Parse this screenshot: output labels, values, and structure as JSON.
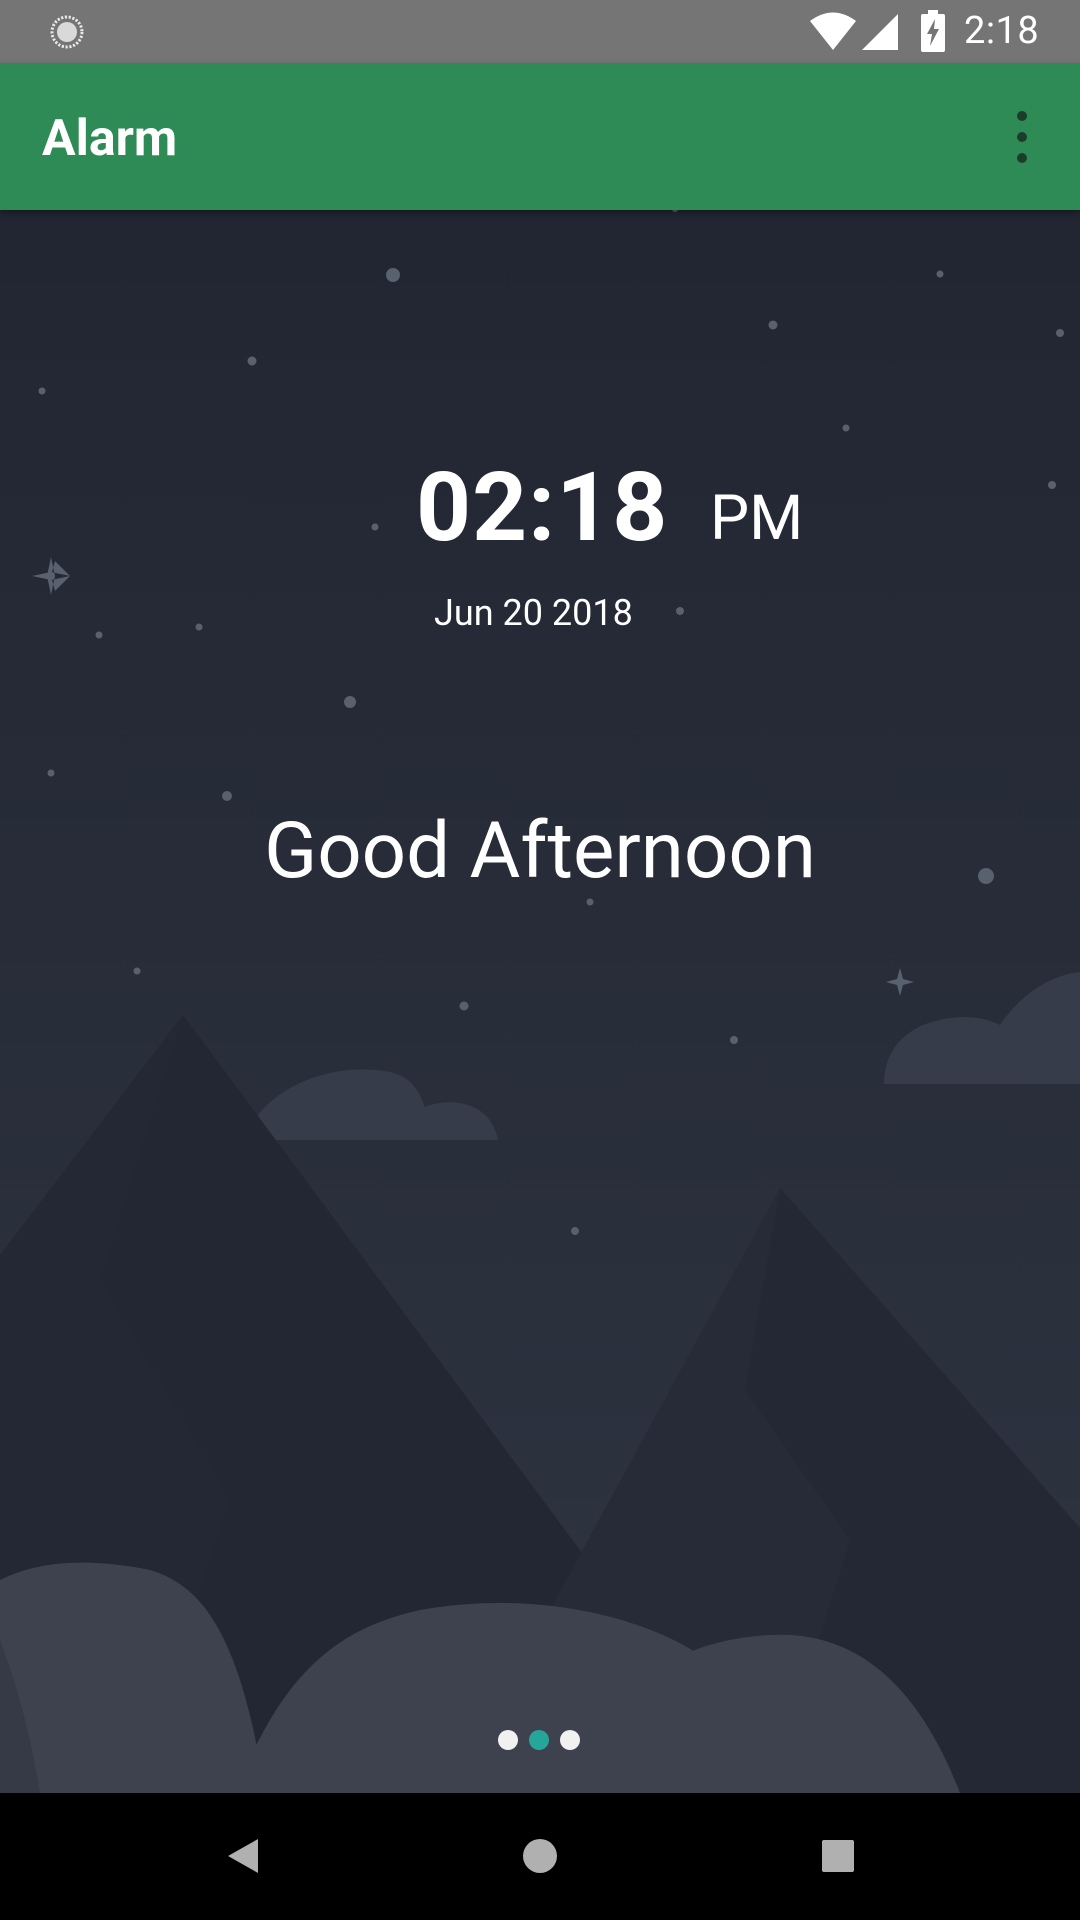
{
  "status_bar": {
    "time": "2:18",
    "left_icon": "sync-circle-icon",
    "icons": [
      "wifi-icon",
      "cellular-signal-icon",
      "battery-charging-icon"
    ]
  },
  "app_bar": {
    "title": "Alarm",
    "menu_icon": "more-vert-icon",
    "background_color": "#2f8b56"
  },
  "clock": {
    "time": "02:18",
    "ampm": "PM",
    "date": "Jun 20 2018"
  },
  "greeting": "Good Afternoon",
  "pager": {
    "page_count": 3,
    "active_index": 1,
    "active_color": "#26a69a"
  },
  "nav_bar": {
    "buttons": [
      "back-icon",
      "home-icon",
      "recents-icon"
    ]
  },
  "colors": {
    "sky_top": "#222632",
    "sky_bottom": "#2e3441",
    "nav_bar": "#000000",
    "status_bar": "#757575"
  }
}
